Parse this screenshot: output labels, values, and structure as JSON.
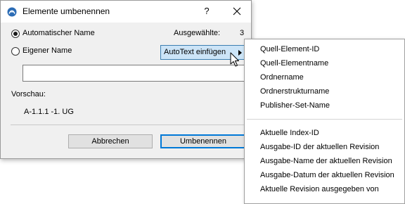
{
  "window": {
    "title": "Elemente umbenennen",
    "help_label": "?",
    "close_icon": "close-icon",
    "app_icon": "archicad-icon"
  },
  "options": {
    "automatic_name_label": "Automatischer Name",
    "automatic_selected": true,
    "custom_name_label": "Eigener Name",
    "custom_selected": false,
    "selected_count_label": "Ausgewählte:",
    "selected_count_value": "3",
    "autotext_button_label": "AutoText einfügen"
  },
  "name_input": {
    "value": "",
    "placeholder": ""
  },
  "preview": {
    "label": "Vorschau:",
    "value": "A-1.1.1 -1. UG"
  },
  "buttons": {
    "cancel_label": "Abbrechen",
    "rename_label": "Umbenennen"
  },
  "autotext_menu": {
    "group1": [
      "Quell-Element-ID",
      "Quell-Elementname",
      "Ordnername",
      "Ordnerstrukturname",
      "Publisher-Set-Name"
    ],
    "group2": [
      "Aktuelle Index-ID",
      "Ausgabe-ID der aktuellen Revision",
      "Ausgabe-Name der aktuellen Revision",
      "Ausgabe-Datum der aktuellen Revision",
      "Aktuelle Revision ausgegeben von"
    ]
  },
  "colors": {
    "dialog_bg": "#f0f0f0",
    "highlight_bg": "#cce4f7",
    "highlight_border": "#3c7fb1",
    "default_button_border": "#0078d7"
  }
}
